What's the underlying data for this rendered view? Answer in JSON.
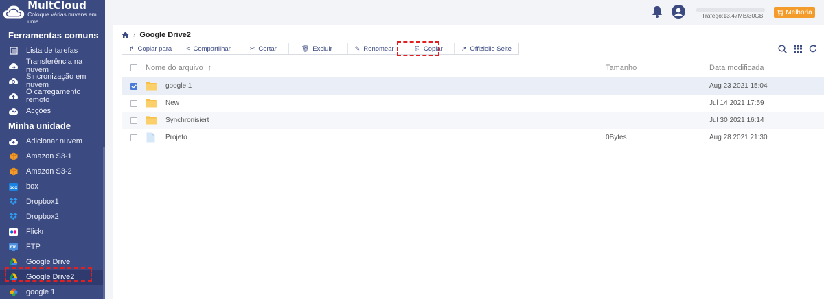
{
  "app": {
    "title": "MultCloud",
    "subtitle": "Coloque várias nuvens em uma"
  },
  "sidebar": {
    "section_common": "Ferramentas comuns",
    "common_items": [
      {
        "label": "Lista de tarefas",
        "icon": "list-icon"
      },
      {
        "label": "Transferência na nuvem",
        "icon": "cloud-transfer-icon"
      },
      {
        "label": "Sincronização em nuvem",
        "icon": "cloud-sync-icon"
      },
      {
        "label": "O carregamento remoto",
        "icon": "cloud-upload-icon"
      },
      {
        "label": "Acções",
        "icon": "cloud-actions-icon"
      }
    ],
    "section_drive": "Minha unidade",
    "drive_items": [
      {
        "label": "Adicionar nuvem",
        "icon": "add-cloud-icon"
      },
      {
        "label": "Amazon S3-1",
        "icon": "amazon-s3-icon"
      },
      {
        "label": "Amazon S3-2",
        "icon": "amazon-s3-icon"
      },
      {
        "label": "box",
        "icon": "box-icon"
      },
      {
        "label": "Dropbox1",
        "icon": "dropbox-icon"
      },
      {
        "label": "Dropbox2",
        "icon": "dropbox-icon"
      },
      {
        "label": "Flickr",
        "icon": "flickr-icon"
      },
      {
        "label": "FTP",
        "icon": "ftp-icon"
      },
      {
        "label": "Google Drive",
        "icon": "google-drive-icon"
      },
      {
        "label": "Google Drive2",
        "icon": "google-drive-icon",
        "active": true
      },
      {
        "label": "google 1",
        "icon": "google-photos-icon"
      }
    ]
  },
  "topbar": {
    "traffic": "Tráfego:13.47MB/30GB",
    "upgrade_label": "Melhoria"
  },
  "breadcrumb": {
    "current": "Google Drive2"
  },
  "toolbar": {
    "copy_to": "Copiar para",
    "share": "Compartilhar",
    "cut": "Cortar",
    "delete": "Excluir",
    "rename": "Renomear",
    "copy": "Copiar",
    "official_site": "Offizielle Seite"
  },
  "table": {
    "col_name": "Nome do arquivo",
    "col_size": "Tamanho",
    "col_date": "Data modificada",
    "rows": [
      {
        "name": "google 1",
        "size": "",
        "date": "Aug 23 2021 15:04",
        "type": "folder",
        "checked": true
      },
      {
        "name": "New",
        "size": "",
        "date": "Jul 14 2021 17:59",
        "type": "folder",
        "checked": false
      },
      {
        "name": "Synchronisiert",
        "size": "",
        "date": "Jul 30 2021 16:14",
        "type": "folder",
        "checked": false
      },
      {
        "name": "Projeto",
        "size": "0Bytes",
        "date": "Aug 28 2021 21:30",
        "type": "file",
        "checked": false
      }
    ]
  },
  "colors": {
    "sidebar_bg": "#3c4a82",
    "accent": "#3c4a82",
    "upgrade": "#f39c2b",
    "folder": "#f7c04a",
    "highlight": "#e02020"
  }
}
